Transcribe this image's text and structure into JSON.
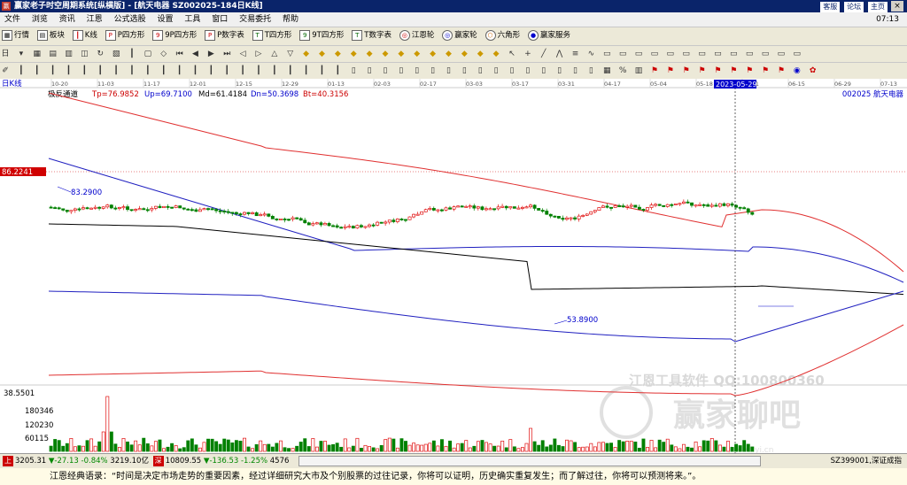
{
  "window": {
    "title": "赢家老子时空周期系统[纵横版] - [航天电器    SZ002025-184日K线]",
    "links": [
      "客服",
      "论坛",
      "主页"
    ],
    "close_glyph": "×"
  },
  "menu": {
    "items": [
      "文件",
      "浏览",
      "资讯",
      "江恩",
      "公式选股",
      "设置",
      "工具",
      "窗口",
      "交易委托",
      "帮助"
    ],
    "right": "07:13"
  },
  "toolbar1": [
    "行情",
    "板块",
    "K线",
    "P四方形",
    "9P四方形",
    "P数字表",
    "T四方形",
    "9T四方形",
    "T数字表",
    "江恩轮",
    "赢家轮",
    "六角形",
    "赢家服务"
  ],
  "chart": {
    "period_label": "日K线",
    "indicator_name": "极反通道",
    "tp_label": "Tp=76.9852",
    "up_label": "Up=69.7100",
    "md_label": "Md=61.4184",
    "dn_label": "Dn=50.3698",
    "bt_label": "Bt=40.3156",
    "stock_label": "002025  航天电器",
    "price_tag": "86.2241",
    "high_label": "83.2900",
    "low_label": "53.8900",
    "vol_top": "38.5501",
    "vol_ticks": [
      "180346",
      "120230",
      "60115"
    ],
    "date_axis": [
      "10-20",
      "11-03",
      "11-17",
      "12-01",
      "12-15",
      "12-29",
      "01-13",
      "02-03",
      "02-17",
      "03-03",
      "03-17",
      "03-31",
      "04-17",
      "05-04",
      "05-18",
      "06-01",
      "06-15",
      "06-29",
      "07-13"
    ],
    "crosshair_date": "2023-05-29",
    "watermark1": "江恩工具软件  QQ:100800360",
    "watermark2": "赢家聊吧",
    "watermark3": "jiaoba.yi.cn",
    "colors": {
      "up": "#e01010",
      "down": "#008000",
      "outer": "#e03030",
      "inner": "#2020c0",
      "mid": "#000000"
    }
  },
  "status": {
    "sh_label": "上",
    "sh_index": "3205.31",
    "sh_change": "▼-27.13",
    "sh_pct": "-0.84%",
    "sh_amount": "3219.10亿",
    "sz_label": "深",
    "sz_index": "10809.55",
    "sz_change": "▼-136.53",
    "sz_pct": "-1.25%",
    "sz_amount": "4576",
    "right_text": "SZ399001,深证成指"
  },
  "quote": "江恩经典语录：“时间是决定市场走势的重要因素，经过详细研究大市及个别股票的过往记录，你将可以证明，历史确实重复发生；而了解过往，你将可以预测将来。”。"
}
